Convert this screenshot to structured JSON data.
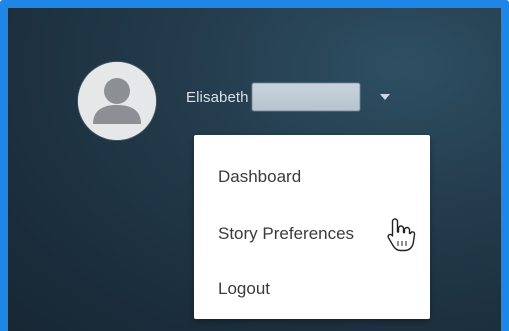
{
  "user": {
    "name": "Elisabeth",
    "avatar_icon": "user-silhouette-icon",
    "caret_icon": "caret-down-icon"
  },
  "menu": {
    "items": [
      {
        "label": "Dashboard"
      },
      {
        "label": "Story Preferences"
      },
      {
        "label": "Logout"
      }
    ],
    "hovered_index": 1
  },
  "colors": {
    "accent_border": "#1e86e6",
    "header_bg": "#1f3444",
    "menu_bg": "#ffffff",
    "menu_text": "#3b3b3b"
  },
  "cursor_icon": "pointer-hand-icon"
}
